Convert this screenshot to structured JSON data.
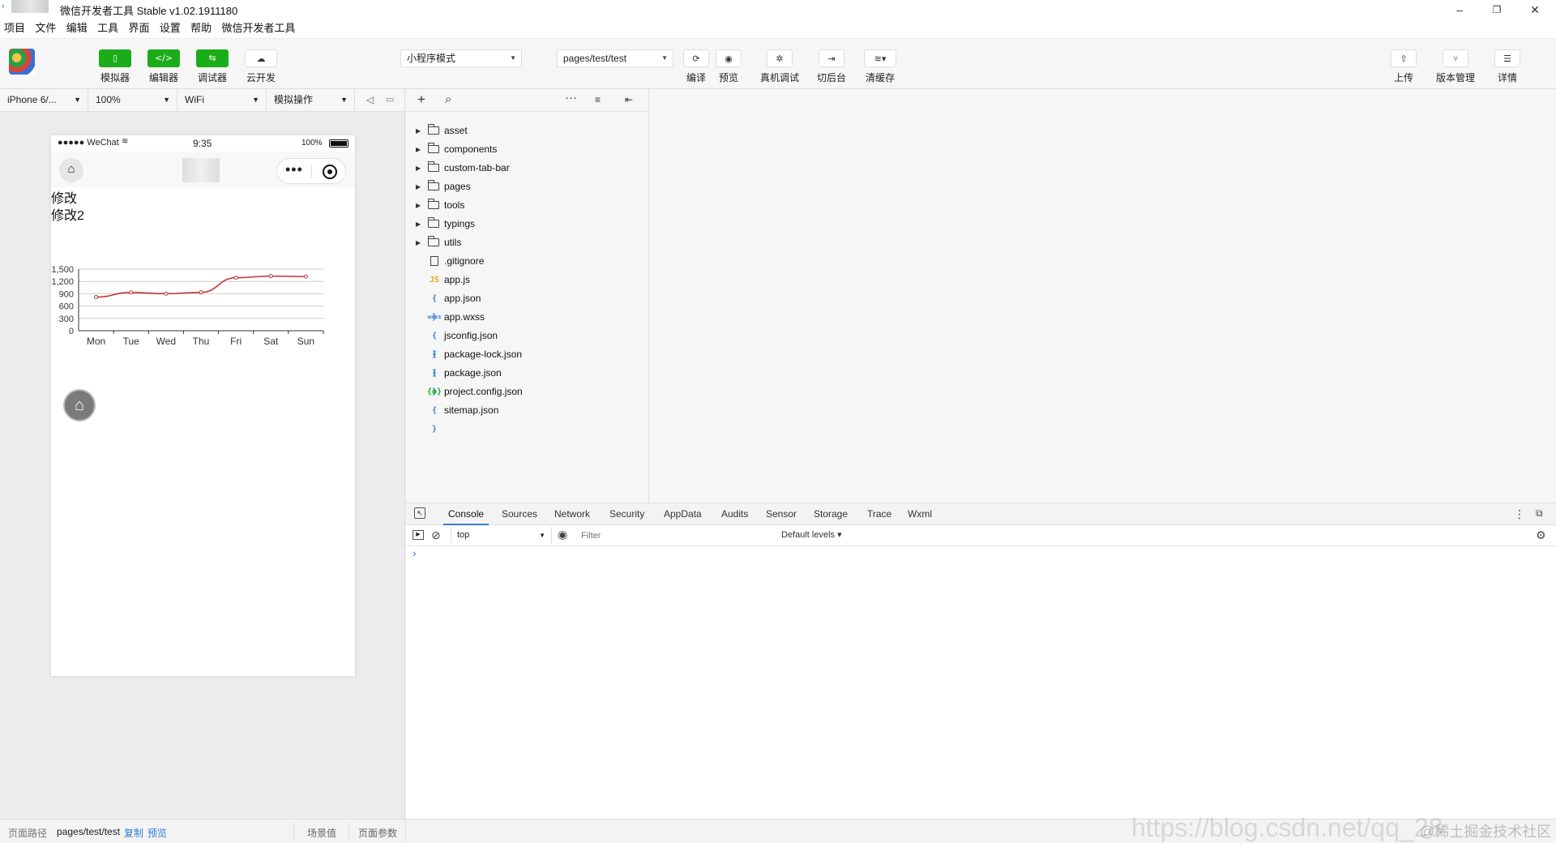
{
  "window": {
    "title": "微信开发者工具 Stable v1.02.1911180"
  },
  "menu": [
    "项目",
    "文件",
    "编辑",
    "工具",
    "界面",
    "设置",
    "帮助",
    "微信开发者工具"
  ],
  "toolbar": {
    "simulator": "模拟器",
    "editor": "编辑器",
    "debugger": "调试器",
    "cloud": "云开发",
    "mode": "小程序模式",
    "page": "pages/test/test",
    "compile": "编译",
    "preview": "预览",
    "remote_debug": "真机调试",
    "background": "切后台",
    "clear_cache": "清缓存",
    "upload": "上传",
    "version": "版本管理",
    "details": "详情"
  },
  "subbar": {
    "device": "iPhone 6/...",
    "zoom": "100%",
    "network": "WiFi",
    "operate": "模拟操作"
  },
  "phone": {
    "carrier": "●●●●● WeChat",
    "time": "9:35",
    "battery": "100%",
    "text1": "修改",
    "text2": "修改2"
  },
  "chart_data": {
    "type": "line",
    "categories": [
      "Mon",
      "Tue",
      "Wed",
      "Thu",
      "Fri",
      "Sat",
      "Sun"
    ],
    "series": [
      {
        "values": [
          820,
          932,
          901,
          934,
          1290,
          1330,
          1320
        ],
        "color": "#c23531"
      }
    ],
    "ylim": [
      0,
      1500
    ],
    "yticks": [
      "1,500",
      "1,200",
      "900",
      "600",
      "300",
      "0"
    ],
    "grid": true
  },
  "files": [
    {
      "name": "asset",
      "type": "folder"
    },
    {
      "name": "components",
      "type": "folder"
    },
    {
      "name": "custom-tab-bar",
      "type": "folder"
    },
    {
      "name": "pages",
      "type": "folder"
    },
    {
      "name": "tools",
      "type": "folder"
    },
    {
      "name": "typings",
      "type": "folder"
    },
    {
      "name": "utils",
      "type": "folder"
    },
    {
      "name": ".gitignore",
      "type": "file"
    },
    {
      "name": "app.js",
      "type": "js"
    },
    {
      "name": "app.json",
      "type": "json"
    },
    {
      "name": "app.wxss",
      "type": "wxss"
    },
    {
      "name": "jsconfig.json",
      "type": "json"
    },
    {
      "name": "package-lock.json",
      "type": "json"
    },
    {
      "name": "package.json",
      "type": "json"
    },
    {
      "name": "project.config.json",
      "type": "config"
    },
    {
      "name": "sitemap.json",
      "type": "json"
    }
  ],
  "file_icons": {
    "js": "JS",
    "json": "{ }",
    "wxss": "wxss",
    "config": "{o}"
  },
  "devtools": {
    "tabs": [
      "Console",
      "Sources",
      "Network",
      "Security",
      "AppData",
      "Audits",
      "Sensor",
      "Storage",
      "Trace",
      "Wxml"
    ],
    "context": "top",
    "filter_placeholder": "Filter",
    "levels": "Default levels ▾",
    "prompt": "›"
  },
  "footer": {
    "path_label": "页面路径",
    "path": "pages/test/test",
    "copy": "复制",
    "preview": "预览",
    "scene": "场景值",
    "params": "页面参数"
  },
  "watermark": "https://blog.csdn.net/qq_28",
  "watermark2": "@稀土掘金技术社区",
  "colors": {
    "green": "#1aad19",
    "accent_blue": "#2e7dd6",
    "line": "#c23531"
  }
}
